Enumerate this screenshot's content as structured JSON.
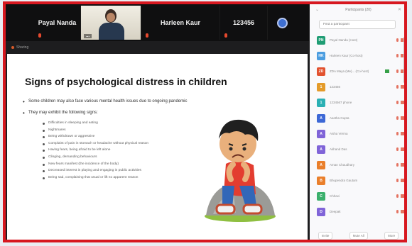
{
  "gallery": {
    "p1_name": "Payal Nanda",
    "p2_caption": "...",
    "p3_name": "Harleen Kaur",
    "p4_name": "123456"
  },
  "share": {
    "label": "Sharing"
  },
  "slide": {
    "title": "Signs of psychological distress in children",
    "bullet1": "Some children may also face various mental health issues due to ongoing pandemic",
    "bullet2": "They may exhibit the following signs:",
    "signs": [
      "Difficulties in sleeping and eating",
      "Nightmares",
      "Being withdrawn or aggressive",
      "Complaint of pain in stomach or headache without physical reason",
      "Having fears, being afraid to be left alone",
      "Clinging, demanding behaviours",
      "New fears manifest (the incidence of the body)",
      "Decreased interest in playing and engaging in public activities",
      "Being sad, complaining that usual or lift no apparent reason"
    ]
  },
  "panel": {
    "title": "Participants (20)",
    "search_placeholder": "Find a participant",
    "participants": [
      {
        "initials": "PN",
        "color": "#1f9d74",
        "name": "Payal Nanda (Host)",
        "green": false
      },
      {
        "initials": "HK",
        "color": "#4b9de0",
        "name": "Harleen Kaur (Co-host)",
        "green": false
      },
      {
        "initials": "ZD",
        "color": "#e2522f",
        "name": "ZDA Maya (Me)... (Co-host)",
        "green": true
      },
      {
        "initials": "1",
        "color": "#e49b2a",
        "name": "123456",
        "green": false
      },
      {
        "initials": "1",
        "color": "#2bb0b4",
        "name": "1234567 phone",
        "green": false
      },
      {
        "initials": "A",
        "color": "#3d68d6",
        "name": "Aastha Gupta",
        "green": false
      },
      {
        "initials": "A",
        "color": "#8064d8",
        "name": "Aisha Verma",
        "green": false
      },
      {
        "initials": "A",
        "color": "#8064d8",
        "name": "Akhand Das",
        "green": false
      },
      {
        "initials": "A",
        "color": "#ea7f2b",
        "name": "Aman Chaudhary",
        "green": false
      },
      {
        "initials": "B",
        "color": "#ea7f2b",
        "name": "Bhupendra Gautam",
        "green": false
      },
      {
        "initials": "C",
        "color": "#3bb06c",
        "name": "Chhavi",
        "green": false
      },
      {
        "initials": "D",
        "color": "#8064d8",
        "name": "Deepak",
        "green": false
      }
    ],
    "footer": {
      "invite": "Invite",
      "mute_all": "Mute All",
      "more": "More"
    }
  }
}
